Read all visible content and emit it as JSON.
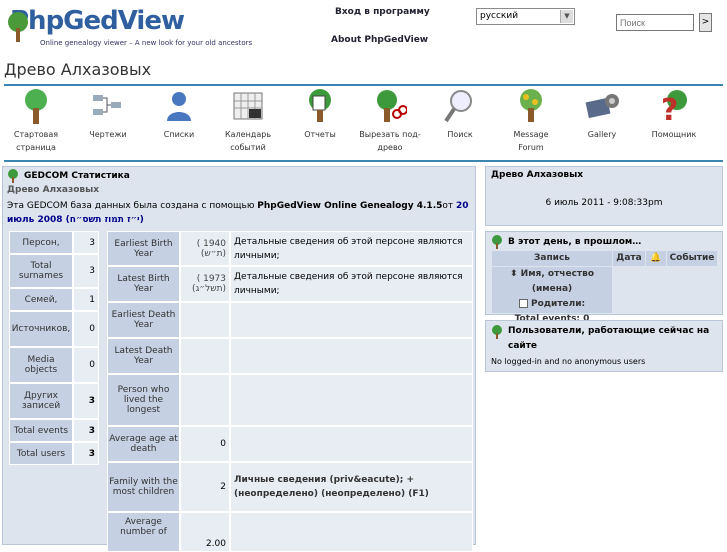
{
  "header": {
    "logo_text": "PhpGedView",
    "logo_tagline": "Online genealogy viewer – A new look for your old ancestors",
    "login_link": "Вход в программу",
    "about_link": "About PhpGedView",
    "language_selected": "русский",
    "search_placeholder": "Поиск",
    "search_button": ">"
  },
  "page_title": "Древо Алхазовых",
  "menu": [
    {
      "label": "Стартовая\nстраница",
      "icon": "home-tree-icon"
    },
    {
      "label": "Чертежи",
      "icon": "charts-icon"
    },
    {
      "label": "Списки",
      "icon": "lists-icon"
    },
    {
      "label": "Календарь\nсобытий",
      "icon": "calendar-icon"
    },
    {
      "label": "Отчеты",
      "icon": "reports-icon"
    },
    {
      "label": "Вырезать под-\nдрево",
      "icon": "clippings-icon"
    },
    {
      "label": "Поиск",
      "icon": "search-icon"
    },
    {
      "label": "Message\nForum",
      "icon": "forum-icon"
    },
    {
      "label": "Gallery",
      "icon": "gallery-icon"
    },
    {
      "label": "Помощник",
      "icon": "help-icon"
    }
  ],
  "stats": {
    "heading": "GEDCOM Статистика",
    "tree_name": "Древо Алхазовых",
    "created_prefix": "Эта GEDCOM база данных была создана с помощью ",
    "created_product": "PhpGedView Online Genealogy 4.1.5",
    "created_mid": "от ",
    "created_date": "20 июль 2008 (י״ז תמוז תשס״ח)",
    "counts": [
      {
        "label": "Персон,",
        "value": "3"
      },
      {
        "label": "Total surnames",
        "value": "3"
      },
      {
        "label": "Семей,",
        "value": "1"
      },
      {
        "label": "Источников,",
        "value": "0"
      },
      {
        "label": "Media objects",
        "value": "0"
      },
      {
        "label": "Других записей",
        "value": "3"
      },
      {
        "label": "Total events",
        "value": "3"
      },
      {
        "label": "Total users",
        "value": "3"
      }
    ],
    "facts": [
      {
        "label": "Earliest Birth Year",
        "value": "( 1940 (ת״ש)",
        "detail": "Детальные сведения об этой персоне являются личными;"
      },
      {
        "label": "Latest Birth Year",
        "value": "( 1973 (תשל״ג)",
        "detail": "Детальные сведения об этой персоне являются личными;"
      },
      {
        "label": "Earliest Death Year",
        "value": "",
        "detail": ""
      },
      {
        "label": "Latest Death Year",
        "value": "",
        "detail": ""
      },
      {
        "label": "Person who lived the longest",
        "value": "",
        "detail": ""
      },
      {
        "label": "Average age at death",
        "value": "0",
        "detail": ""
      },
      {
        "label": "Family with the most children",
        "value": "2",
        "detail": "Личные сведения (priv&eacute); + (неопределено) (неопределено) (F1)"
      },
      {
        "label": "Average number of",
        "value": "2.00",
        "detail": ""
      }
    ]
  },
  "side_tree": {
    "title": "Древо Алхазовых",
    "datetime": "6 июль 2011 - 9:08:33pm"
  },
  "on_this_day": {
    "title": "В этот день, в прошлом…",
    "col_record": "Запись",
    "col_date": "Дата",
    "col_event": "Событие",
    "row_name": "Имя, отчество (имена)",
    "parents_label": "Родители:",
    "total_events": "Total events: 0"
  },
  "users_online": {
    "title": "Пользователи, работающие сейчас на сайте",
    "text": "No logged-in and no anonymous users"
  },
  "colors": {
    "accent": "#3a86b0",
    "panel_bg": "#dde4ee",
    "label_bg": "#c5d1e2",
    "link": "#00008b"
  }
}
